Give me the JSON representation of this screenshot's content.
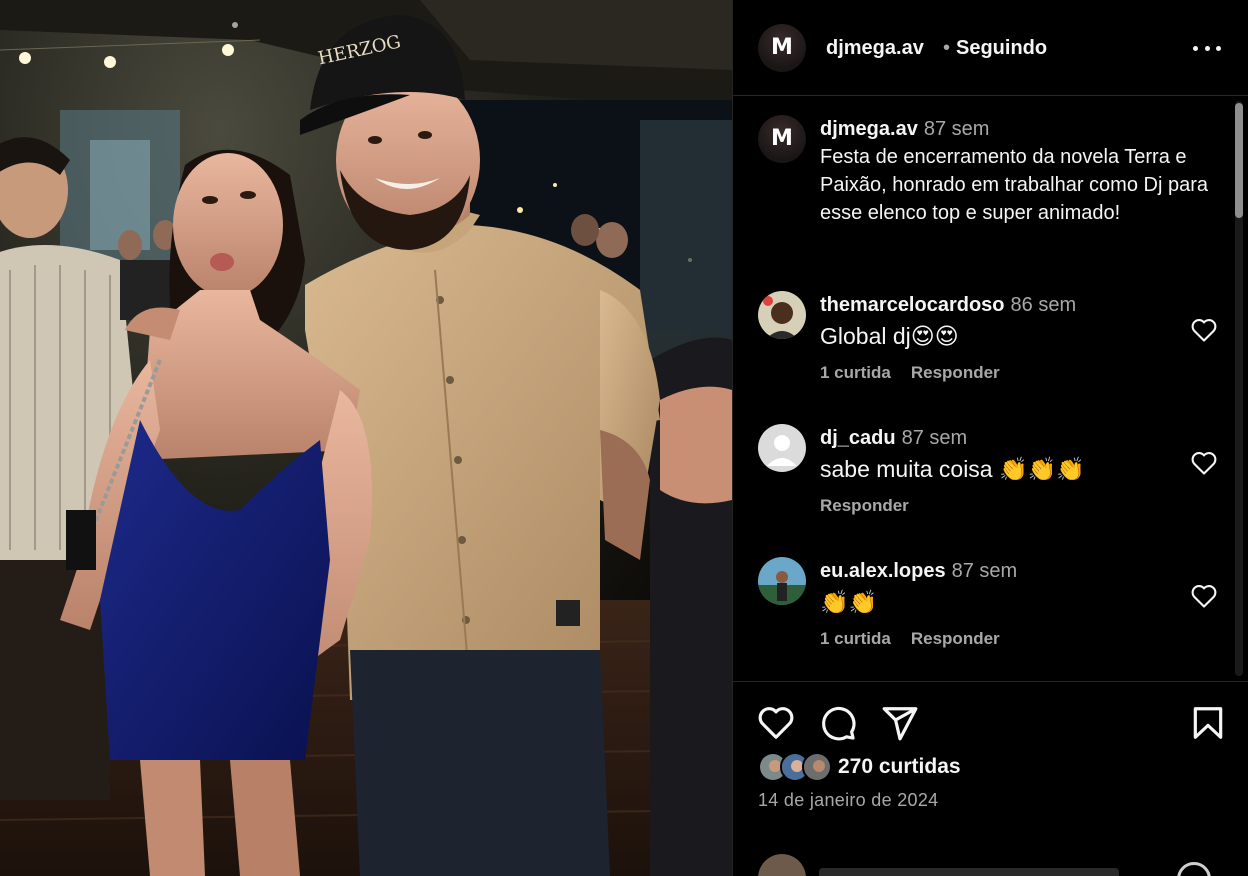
{
  "photo": {
    "cap_text": "HERZOG",
    "description_icon": "photo-image"
  },
  "header": {
    "username": "djmega.av",
    "separator": "•",
    "follow_status": "Seguindo",
    "more_icon": "more-horizontal-icon"
  },
  "caption": {
    "username": "djmega.av",
    "time": "87 sem",
    "text": "Festa de encerramento da novela Terra e Paixão, honrado em trabalhar como Dj para esse elenco top e super animado!"
  },
  "comments": [
    {
      "username": "themarcelocardoso",
      "time": "86 sem",
      "text": "Global dj😍😍",
      "likes": "1 curtida",
      "reply": "Responder"
    },
    {
      "username": "dj_cadu",
      "time": "87 sem",
      "text": "sabe muita coisa 👏👏👏",
      "likes": "",
      "reply": "Responder"
    },
    {
      "username": "eu.alex.lopes",
      "time": "87 sem",
      "text": "👏👏",
      "likes": "1 curtida",
      "reply": "Responder"
    }
  ],
  "actions": {
    "like_icon": "heart-icon",
    "comment_icon": "comment-icon",
    "share_icon": "send-icon",
    "save_icon": "bookmark-icon"
  },
  "likes": {
    "count_text": "270 curtidas"
  },
  "date": "14 de janeiro de 2024",
  "colors": {
    "background": "#000000",
    "text": "#f5f5f5",
    "muted": "#a8a8a8",
    "divider": "#262626"
  }
}
